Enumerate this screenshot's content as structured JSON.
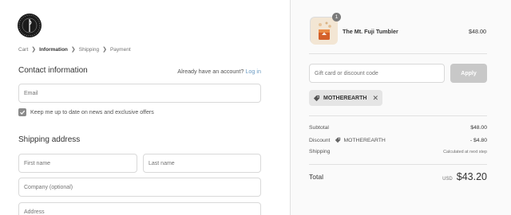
{
  "breadcrumb": {
    "cart": "Cart",
    "information": "Information",
    "shipping": "Shipping",
    "payment": "Payment"
  },
  "contact": {
    "title": "Contact information",
    "account_prompt": "Already have an account?",
    "login_link": "Log in",
    "email_placeholder": "Email",
    "newsletter_label": "Keep me up to date on news and exclusive offers",
    "newsletter_checked": true
  },
  "shipping": {
    "title": "Shipping address",
    "first_name_placeholder": "First name",
    "last_name_placeholder": "Last name",
    "company_placeholder": "Company (optional)",
    "address_placeholder": "Address"
  },
  "order": {
    "product_name": "The Mt. Fuji Tumbler",
    "product_price": "$48.00",
    "quantity": "1",
    "discount_placeholder": "Gift card or discount code",
    "apply_label": "Apply",
    "applied_code": "MOTHEREARTH",
    "subtotal_label": "Subtotal",
    "subtotal_value": "$48.00",
    "discount_label": "Discount",
    "discount_code": "MOTHEREARTH",
    "discount_value": "- $4.80",
    "shipping_label": "Shipping",
    "shipping_value": "Calculated at next step",
    "total_label": "Total",
    "currency": "USD",
    "total_value": "$43.20"
  },
  "colors": {
    "link": "#6b9bc3",
    "apply_disabled": "#c8c8c8",
    "sidebar_bg": "#fafafa"
  }
}
